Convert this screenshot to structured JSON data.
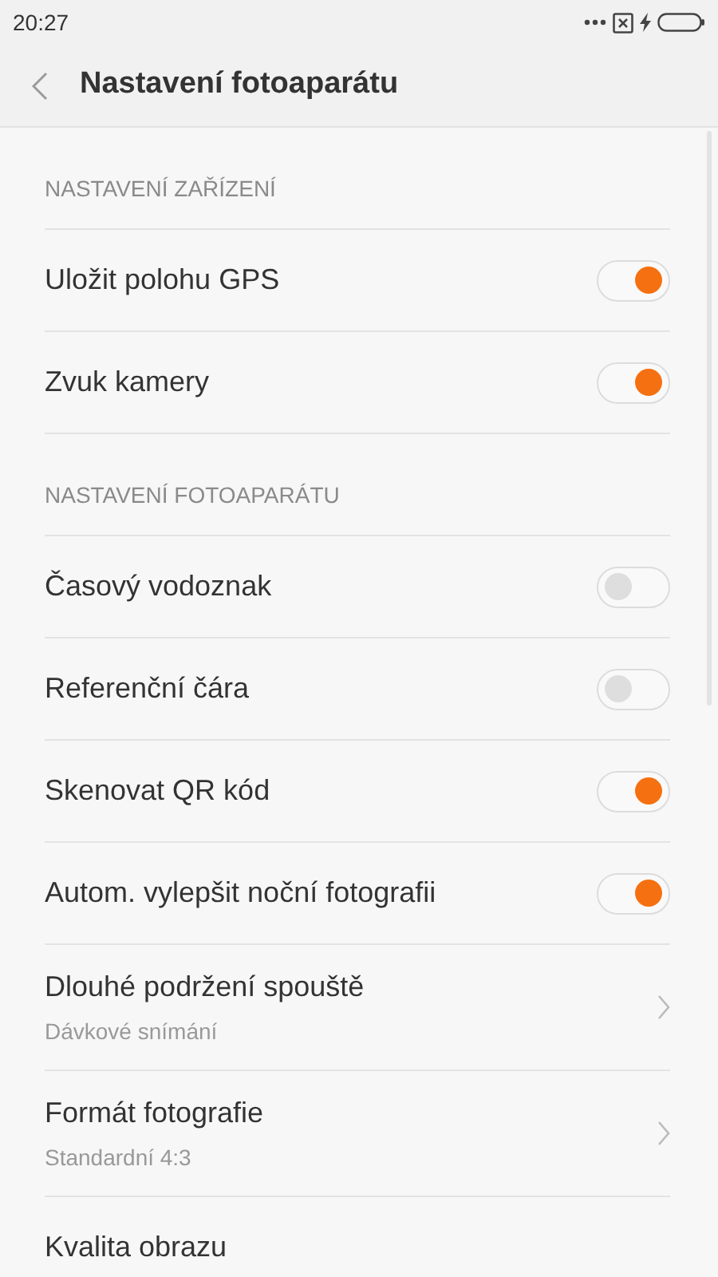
{
  "status_bar": {
    "time": "20:27"
  },
  "header": {
    "title": "Nastavení fotoaparátu"
  },
  "sections": [
    {
      "title": "NASTAVENÍ ZAŘÍZENÍ",
      "items": [
        {
          "kind": "toggle",
          "label": "Uložit polohu GPS",
          "on": true
        },
        {
          "kind": "toggle",
          "label": "Zvuk kamery",
          "on": true
        }
      ]
    },
    {
      "title": "NASTAVENÍ FOTOAPARÁTU",
      "items": [
        {
          "kind": "toggle",
          "label": "Časový vodoznak",
          "on": false
        },
        {
          "kind": "toggle",
          "label": "Referenční čára",
          "on": false
        },
        {
          "kind": "toggle",
          "label": "Skenovat QR kód",
          "on": true
        },
        {
          "kind": "toggle",
          "label": "Autom. vylepšit noční fotografii",
          "on": true
        },
        {
          "kind": "link",
          "label": "Dlouhé podržení spouště",
          "value": "Dávkové snímání"
        },
        {
          "kind": "link",
          "label": "Formát fotografie",
          "value": "Standardní 4:3"
        },
        {
          "kind": "link",
          "label": "Kvalita obrazu"
        }
      ]
    }
  ]
}
